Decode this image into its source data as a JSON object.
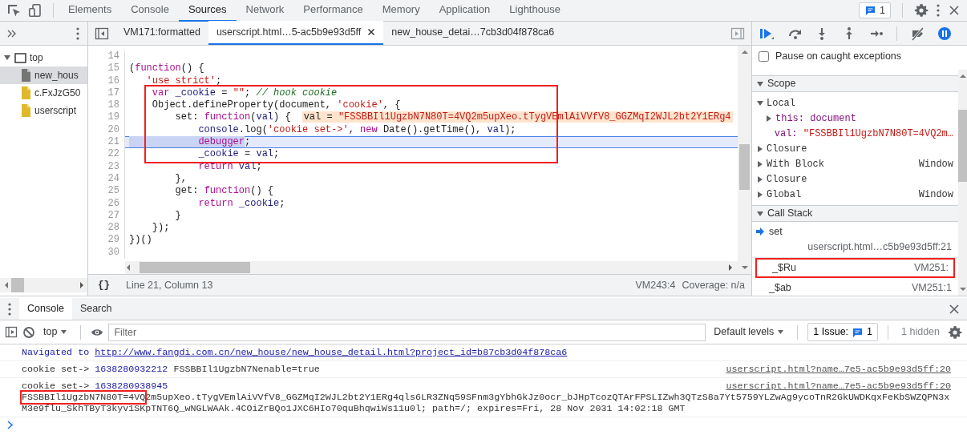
{
  "main_tabs": [
    {
      "label": "Elements",
      "selected": false
    },
    {
      "label": "Console",
      "selected": false
    },
    {
      "label": "Sources",
      "selected": true
    },
    {
      "label": "Network",
      "selected": false
    },
    {
      "label": "Performance",
      "selected": false
    },
    {
      "label": "Memory",
      "selected": false
    },
    {
      "label": "Application",
      "selected": false
    },
    {
      "label": "Lighthouse",
      "selected": false
    }
  ],
  "issues_badge": {
    "count": "1"
  },
  "navigator": {
    "tree": [
      {
        "label": "top",
        "kind": "frame",
        "expanded": true,
        "selected": false,
        "children": [
          {
            "label": "new_hous",
            "kind": "document",
            "selected": true
          },
          {
            "label": "c.FxJzG50",
            "kind": "script",
            "selected": false
          },
          {
            "label": "userscript",
            "kind": "script",
            "selected": false
          }
        ]
      }
    ]
  },
  "editor_tabs": [
    {
      "label": "VM171:formatted",
      "selected": false,
      "closable": false
    },
    {
      "label": "userscript.html…5-ac5b9e93d5ff",
      "selected": true,
      "closable": true
    },
    {
      "label": "new_house_detai…7cb3d04f878ca6",
      "selected": false,
      "closable": false
    }
  ],
  "code": {
    "lines": [
      {
        "number": "14",
        "current": false,
        "framed": false
      },
      {
        "number": "15",
        "current": false,
        "framed": false,
        "tokens": [
          {
            "kind": "plain",
            "text": "("
          },
          {
            "kind": "keyword",
            "text": "function"
          },
          {
            "kind": "plain",
            "text": "() {"
          }
        ]
      },
      {
        "number": "16",
        "current": false,
        "framed": false,
        "tokens": [
          {
            "kind": "string",
            "text": "   'use strict'"
          },
          {
            "kind": "plain",
            "text": ";"
          }
        ]
      },
      {
        "number": "17",
        "current": false,
        "framed": true,
        "tokens": [
          {
            "kind": "keyword",
            "text": "    var "
          },
          {
            "kind": "name",
            "text": "_cookie"
          },
          {
            "kind": "plain",
            "text": " = "
          },
          {
            "kind": "string",
            "text": "\"\""
          },
          {
            "kind": "plain",
            "text": "; "
          },
          {
            "kind": "comment",
            "text": "// hook cookie"
          }
        ]
      },
      {
        "number": "18",
        "current": false,
        "framed": true,
        "tokens": [
          {
            "kind": "plain",
            "text": "    Object.defineProperty(document, "
          },
          {
            "kind": "string",
            "text": "'cookie'"
          },
          {
            "kind": "plain",
            "text": ", {"
          }
        ]
      },
      {
        "number": "19",
        "current": false,
        "framed": true,
        "tokens": [
          {
            "kind": "plain",
            "text": "        set: "
          },
          {
            "kind": "keyword",
            "text": "function"
          },
          {
            "kind": "plain",
            "text": "("
          },
          {
            "kind": "name",
            "text": "val"
          },
          {
            "kind": "plain",
            "text": ") {"
          }
        ],
        "inline_value": {
          "name": "val = ",
          "value": "\"FSSBBIl1UgzbN7N80T=4VQ2m5upXeo.tTygVEmlAiVVfV8_GGZMqI2WJL2bt2Y1ERg4"
        }
      },
      {
        "number": "20",
        "current": false,
        "framed": true,
        "tokens": [
          {
            "kind": "name",
            "text": "            console"
          },
          {
            "kind": "plain",
            "text": ".log("
          },
          {
            "kind": "string",
            "text": "'cookie set->'"
          },
          {
            "kind": "plain",
            "text": ", "
          },
          {
            "kind": "keyword",
            "text": "new"
          },
          {
            "kind": "plain",
            "text": " Date().getTime(), "
          },
          {
            "kind": "name",
            "text": "val"
          },
          {
            "kind": "plain",
            "text": ");"
          }
        ]
      },
      {
        "number": "21",
        "current": true,
        "framed": true,
        "tokens": [
          {
            "kind": "selected_keyword",
            "text": "            debugger"
          },
          {
            "kind": "plain",
            "text": ";"
          }
        ]
      },
      {
        "number": "22",
        "current": false,
        "framed": true,
        "tokens": [
          {
            "kind": "name",
            "text": "            _cookie"
          },
          {
            "kind": "plain",
            "text": " = "
          },
          {
            "kind": "name",
            "text": "val"
          },
          {
            "kind": "plain",
            "text": ";"
          }
        ]
      },
      {
        "number": "23",
        "current": false,
        "framed": false,
        "tokens": [
          {
            "kind": "keyword",
            "text": "            return "
          },
          {
            "kind": "name",
            "text": "val"
          },
          {
            "kind": "plain",
            "text": ";"
          }
        ]
      },
      {
        "number": "24",
        "current": false,
        "framed": false,
        "tokens": [
          {
            "kind": "plain",
            "text": "        },"
          }
        ]
      },
      {
        "number": "25",
        "current": false,
        "framed": false,
        "tokens": [
          {
            "kind": "plain",
            "text": "        get: "
          },
          {
            "kind": "keyword",
            "text": "function"
          },
          {
            "kind": "plain",
            "text": "() {"
          }
        ]
      },
      {
        "number": "26",
        "current": false,
        "framed": false,
        "tokens": [
          {
            "kind": "keyword",
            "text": "            return "
          },
          {
            "kind": "name",
            "text": "_cookie"
          },
          {
            "kind": "plain",
            "text": ";"
          }
        ]
      },
      {
        "number": "27",
        "current": false,
        "framed": false,
        "tokens": [
          {
            "kind": "plain",
            "text": "        }"
          }
        ]
      },
      {
        "number": "28",
        "current": false,
        "framed": false,
        "tokens": [
          {
            "kind": "plain",
            "text": "    });"
          }
        ]
      },
      {
        "number": "29",
        "current": false,
        "framed": false,
        "tokens": [
          {
            "kind": "plain",
            "text": "})()"
          }
        ]
      },
      {
        "number": "30",
        "current": false,
        "framed": false
      }
    ]
  },
  "status_bar": {
    "pretty_print": "{}",
    "position": "Line 21, Column 13",
    "location": "VM243:4",
    "coverage": "Coverage: n/a"
  },
  "debugger": {
    "pause_on_caught": {
      "label": "Pause on caught exceptions",
      "checked": false
    },
    "scope": {
      "title": "Scope",
      "expanded": true,
      "items": [
        {
          "label": "Local",
          "expanded": true,
          "children": [
            {
              "name": "this:",
              "value": "document",
              "kind": "object"
            },
            {
              "name": "val:",
              "value": "\"FSSBBIl1UgzbN7N80T=4VQ2m…",
              "kind": "string"
            }
          ]
        },
        {
          "label": "Closure",
          "expanded": false
        },
        {
          "label": "With Block",
          "hint": "Window",
          "expanded": false
        },
        {
          "label": "Closure",
          "expanded": false
        },
        {
          "label": "Global",
          "hint": "Window",
          "expanded": false
        }
      ]
    },
    "call_stack": {
      "title": "Call Stack",
      "expanded": true,
      "frames": [
        {
          "function": "set",
          "location": "userscript.html…c5b9e93d5ff:21",
          "current": true,
          "framed": false
        },
        {
          "function": "_$Ru",
          "location": "VM251:",
          "current": false,
          "framed": true
        },
        {
          "function": "_$ab",
          "location": "VM251:1",
          "current": false,
          "framed": false
        }
      ]
    }
  },
  "drawer": {
    "tabs": [
      {
        "label": "Console",
        "selected": true
      },
      {
        "label": "Search",
        "selected": false
      }
    ],
    "context": "top",
    "filter_placeholder": "Filter",
    "levels": "Default levels",
    "issues_label": "1 Issue:",
    "issues_count": "1",
    "hidden": "1 hidden",
    "messages": [
      {
        "kind": "navigation",
        "text": "Navigated to",
        "url": "http://www.fangdi.com.cn/new_house/new_house_detail.html?project_id=b87cb3d04f878ca6"
      },
      {
        "kind": "log",
        "prefix": "cookie set->",
        "number": "1638280932212",
        "value": "FSSBBIl1UgzbN7Nenable=true",
        "source": "userscript.html?name…7e5-ac5b9e93d5ff:20"
      },
      {
        "kind": "log_block",
        "prefix": "cookie set->",
        "number": "1638280938945",
        "value_framed": "FSSBBIl1UgzbN7N80T=4VQ",
        "value": "2m5upXeo.tTygVEmlAiVVfV8_GGZMqI2WJL2bt2Y1ERg4qls6LR3ZNq59SFnm3gYbhGkJz0ocr_bJHpTcozQTArFPSLIZwh3QTzS8a7Yt5759YLZwAg9ycoTnR2GkUWDKqxFeKbSWZQPN3xM3e9flu_SkhTByT3kyv1SKpTNT6Q_wNGLWAAk.4COiZrBQo1JXC6HIo70quBhqwiWs11u0l; path=/; expires=Fri, 28 Nov 2031 14:02:18 GMT",
        "source": "userscript.html?name…7e5-ac5b9e93d5ff:20"
      }
    ]
  }
}
